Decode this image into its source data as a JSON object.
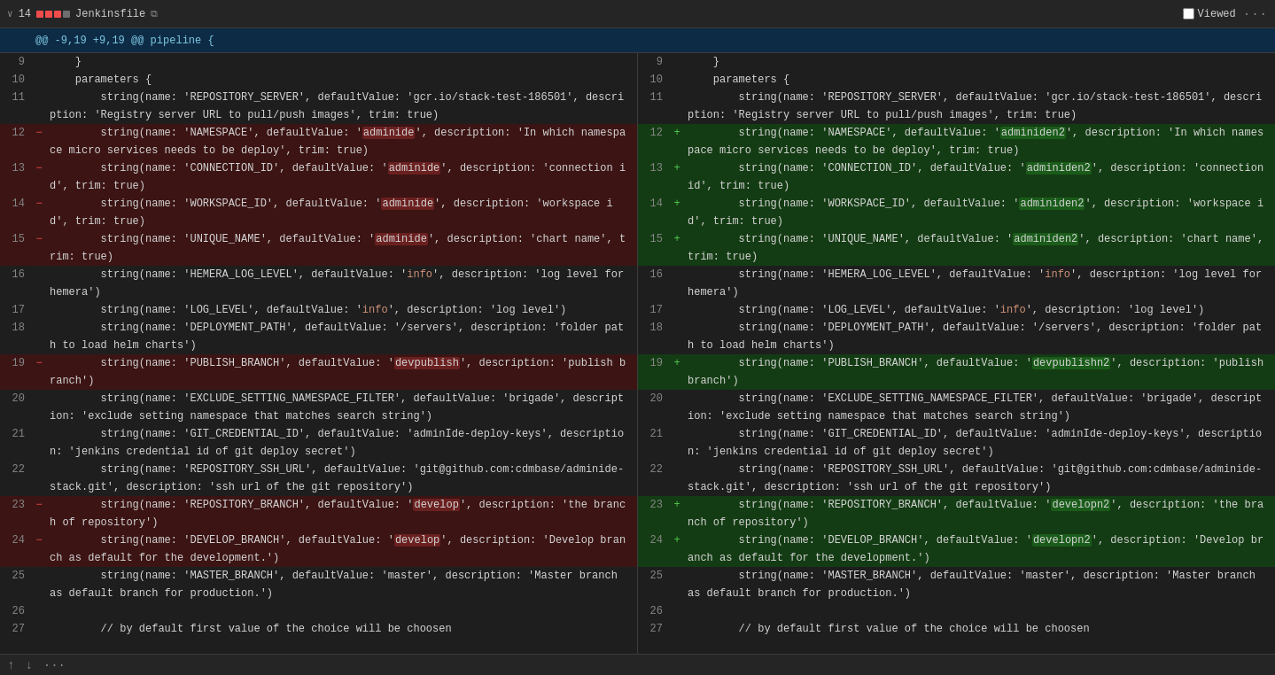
{
  "topbar": {
    "chevron_down": "∨",
    "file_count": "14",
    "filename": "Jenkinsfile",
    "copy_tooltip": "Copy",
    "viewed_label": "Viewed",
    "more_label": "···"
  },
  "diff_header": {
    "text": "@@ -9,19 +9,19 @@ pipeline {"
  },
  "bottom_bar": {
    "up_arrow": "↑",
    "down_arrow": "↓",
    "dots": "···"
  }
}
